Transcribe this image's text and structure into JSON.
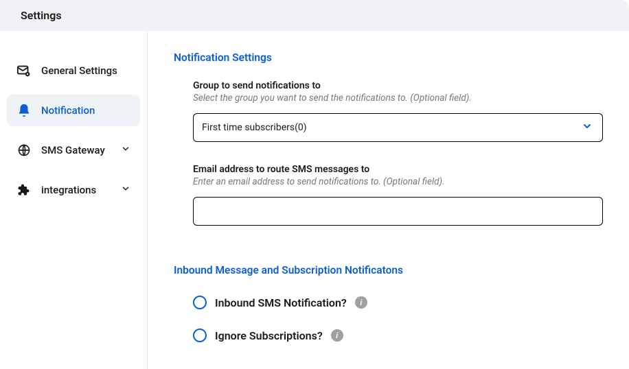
{
  "header": {
    "title": "Settings"
  },
  "sidebar": {
    "items": [
      {
        "label": "General Settings"
      },
      {
        "label": "Notification"
      },
      {
        "label": "SMS Gateway"
      },
      {
        "label": "integrations"
      }
    ]
  },
  "main": {
    "section1_title": "Notification Settings",
    "group_field": {
      "label": "Group to send notifications to",
      "help": "Select the group you want to send the notifications to. (Optional field).",
      "value": "First time subscribers(0)"
    },
    "email_field": {
      "label": "Email address to route SMS messages to",
      "help": "Enter an email address to send notifications to. (Optional field).",
      "value": ""
    },
    "section2_title": "Inbound Message and Subscription Notificatons",
    "option1_label": "Inbound SMS Notification?",
    "option2_label": "Ignore Subscriptions?"
  }
}
